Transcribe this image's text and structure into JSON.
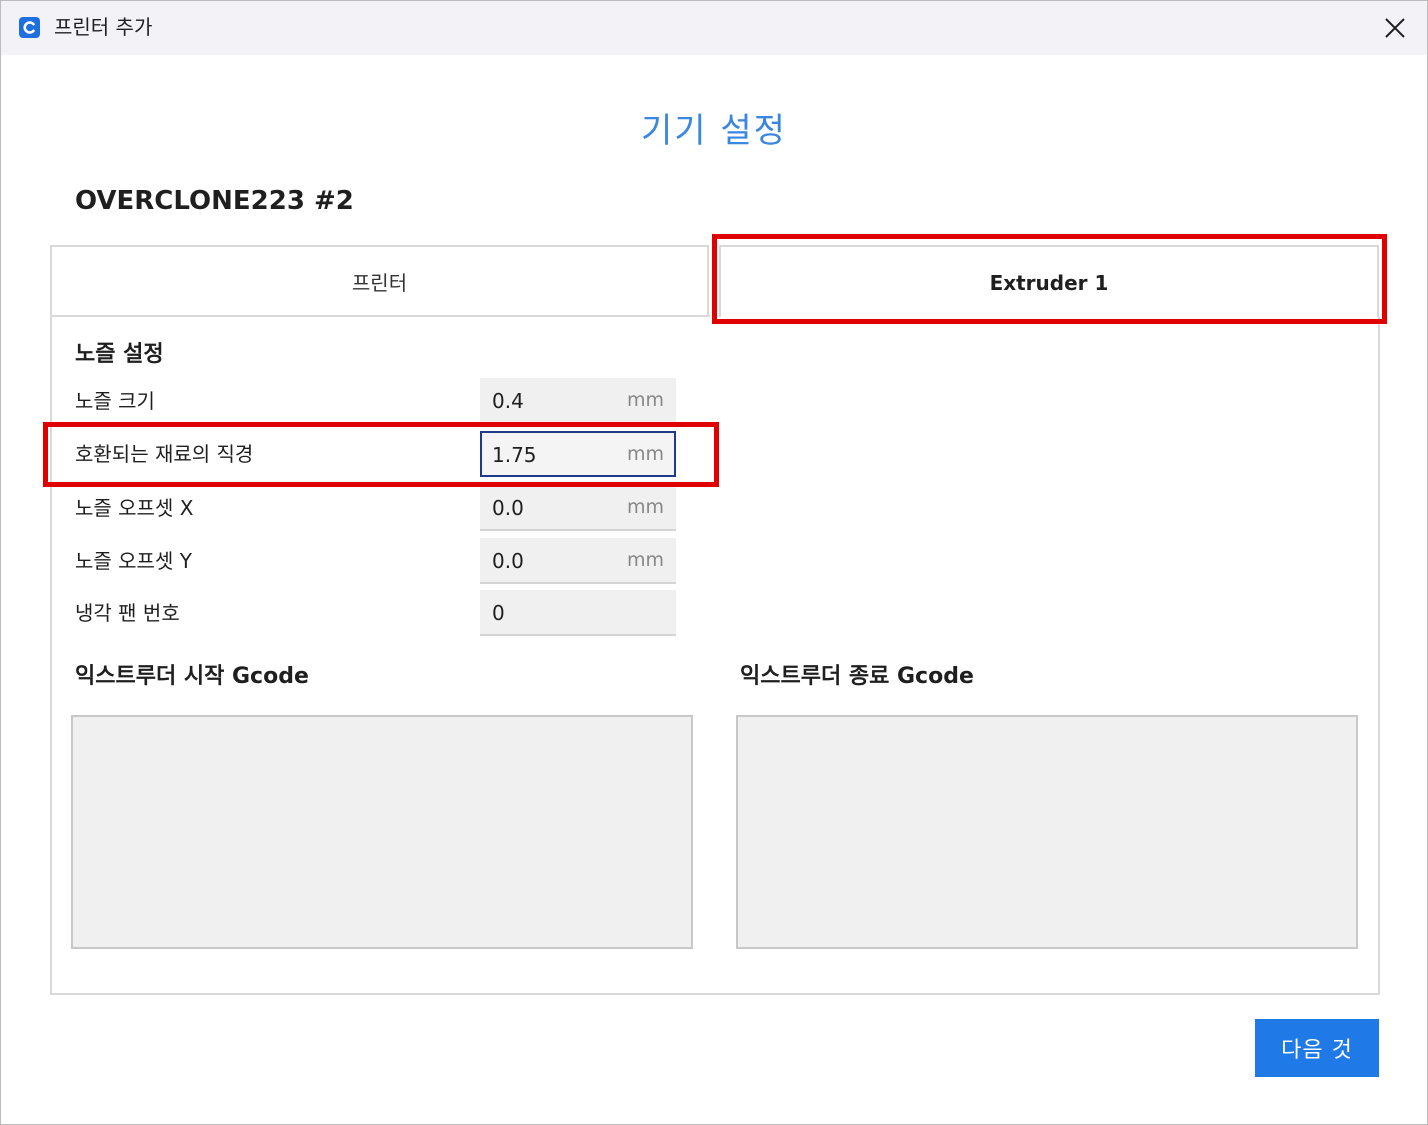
{
  "window": {
    "title": "프린터 추가",
    "app_icon": "cura-c-icon",
    "close_icon": "close-icon"
  },
  "heading": "기기 설정",
  "printer_name": "OVERCLONE223 #2",
  "tabs": [
    {
      "label": "프린터",
      "selected": false
    },
    {
      "label": "Extruder 1",
      "selected": true
    }
  ],
  "nozzle_settings": {
    "title": "노즐 설정",
    "rows": [
      {
        "label": "노즐 크기",
        "value": "0.4",
        "unit": "mm"
      },
      {
        "label": "호환되는 재료의 직경",
        "value": "1.75",
        "unit": "mm"
      },
      {
        "label": "노즐 오프셋 X",
        "value": "0.0",
        "unit": "mm"
      },
      {
        "label": "노즐 오프셋 Y",
        "value": "0.0",
        "unit": "mm"
      },
      {
        "label": "냉각 팬 번호",
        "value": "0",
        "unit": ""
      }
    ]
  },
  "gcode": {
    "start_title": "익스트루더 시작 Gcode",
    "start_value": "",
    "end_title": "익스트루더 종료 Gcode",
    "end_value": ""
  },
  "next_button": "다음 것",
  "colors": {
    "accent": "#1f7ae8",
    "heading": "#3a86e0",
    "highlight": "#e00000"
  }
}
